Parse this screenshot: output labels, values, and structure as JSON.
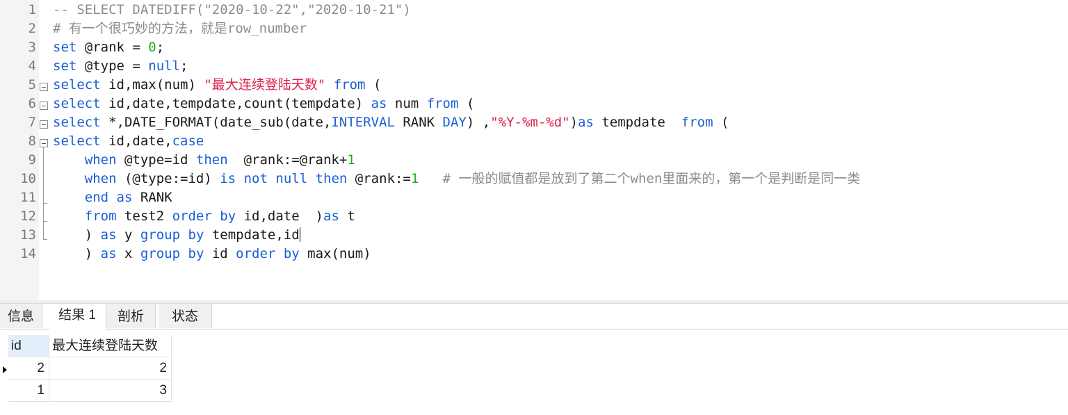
{
  "editor": {
    "lines": [
      {
        "n": "1",
        "segs": [
          {
            "t": "-- SELECT DATEDIFF(\"2020-10-22\",\"2020-10-21\")",
            "c": "cmt"
          }
        ]
      },
      {
        "n": "2",
        "segs": [
          {
            "t": "# 有一个很巧妙的方法，就是row_number",
            "c": "cmt"
          }
        ]
      },
      {
        "n": "3",
        "segs": [
          {
            "t": "set",
            "c": "kw"
          },
          {
            "t": " @rank = "
          },
          {
            "t": "0",
            "c": "num"
          },
          {
            "t": ";"
          }
        ]
      },
      {
        "n": "4",
        "segs": [
          {
            "t": "set",
            "c": "kw"
          },
          {
            "t": " @type = "
          },
          {
            "t": "null",
            "c": "kw"
          },
          {
            "t": ";"
          }
        ]
      },
      {
        "n": "5",
        "segs": [
          {
            "t": "select",
            "c": "kw"
          },
          {
            "t": " id,max(num) "
          },
          {
            "t": "\"最大连续登陆天数\"",
            "c": "str"
          },
          {
            "t": " "
          },
          {
            "t": "from",
            "c": "kw"
          },
          {
            "t": " ("
          }
        ]
      },
      {
        "n": "6",
        "segs": [
          {
            "t": "select",
            "c": "kw"
          },
          {
            "t": " id,date,tempdate,count(tempdate) "
          },
          {
            "t": "as",
            "c": "kw"
          },
          {
            "t": " num "
          },
          {
            "t": "from",
            "c": "kw"
          },
          {
            "t": " ("
          }
        ]
      },
      {
        "n": "7",
        "segs": [
          {
            "t": "select",
            "c": "kw"
          },
          {
            "t": " *,DATE_FORMAT(date_sub(date,"
          },
          {
            "t": "INTERVAL",
            "c": "kw"
          },
          {
            "t": " RANK "
          },
          {
            "t": "DAY",
            "c": "kw"
          },
          {
            "t": ") ,"
          },
          {
            "t": "\"%Y-%m-%d\"",
            "c": "str"
          },
          {
            "t": ")"
          },
          {
            "t": "as",
            "c": "kw"
          },
          {
            "t": " tempdate  "
          },
          {
            "t": "from",
            "c": "kw"
          },
          {
            "t": " ("
          }
        ]
      },
      {
        "n": "8",
        "segs": [
          {
            "t": "select",
            "c": "kw"
          },
          {
            "t": " id,date,"
          },
          {
            "t": "case",
            "c": "kw"
          }
        ]
      },
      {
        "n": "9",
        "segs": [
          {
            "t": "    "
          },
          {
            "t": "when",
            "c": "kw"
          },
          {
            "t": " @type=id "
          },
          {
            "t": "then",
            "c": "kw"
          },
          {
            "t": "  @rank:=@rank+"
          },
          {
            "t": "1",
            "c": "num"
          }
        ]
      },
      {
        "n": "10",
        "segs": [
          {
            "t": "    "
          },
          {
            "t": "when",
            "c": "kw"
          },
          {
            "t": " (@type:=id) "
          },
          {
            "t": "is",
            "c": "kw"
          },
          {
            "t": " "
          },
          {
            "t": "not",
            "c": "kw"
          },
          {
            "t": " "
          },
          {
            "t": "null",
            "c": "kw"
          },
          {
            "t": " "
          },
          {
            "t": "then",
            "c": "kw"
          },
          {
            "t": " @rank:="
          },
          {
            "t": "1",
            "c": "num"
          },
          {
            "t": "   # 一般的赋值都是放到了第二个when里面来的，第一个是判断是同一类",
            "c": "cmt"
          }
        ]
      },
      {
        "n": "11",
        "segs": [
          {
            "t": "    "
          },
          {
            "t": "end",
            "c": "kw"
          },
          {
            "t": " "
          },
          {
            "t": "as",
            "c": "kw"
          },
          {
            "t": " RANK"
          }
        ]
      },
      {
        "n": "12",
        "segs": [
          {
            "t": "    "
          },
          {
            "t": "from",
            "c": "kw"
          },
          {
            "t": " test2 "
          },
          {
            "t": "order",
            "c": "kw"
          },
          {
            "t": " "
          },
          {
            "t": "by",
            "c": "kw"
          },
          {
            "t": " id,date  )"
          },
          {
            "t": "as",
            "c": "kw"
          },
          {
            "t": " t"
          }
        ]
      },
      {
        "n": "13",
        "segs": [
          {
            "t": "    ) "
          },
          {
            "t": "as",
            "c": "kw"
          },
          {
            "t": " y "
          },
          {
            "t": "group",
            "c": "kw"
          },
          {
            "t": " "
          },
          {
            "t": "by",
            "c": "kw"
          },
          {
            "t": " tempdate,id"
          }
        ]
      },
      {
        "n": "14",
        "segs": [
          {
            "t": "    ) "
          },
          {
            "t": "as",
            "c": "kw"
          },
          {
            "t": " x "
          },
          {
            "t": "group",
            "c": "kw"
          },
          {
            "t": " "
          },
          {
            "t": "by",
            "c": "kw"
          },
          {
            "t": " id "
          },
          {
            "t": "order",
            "c": "kw"
          },
          {
            "t": " "
          },
          {
            "t": "by",
            "c": "kw"
          },
          {
            "t": " max(num)"
          }
        ]
      }
    ]
  },
  "tabs": {
    "info": "信息",
    "result1": "结果 1",
    "profile": "剖析",
    "status": "状态"
  },
  "grid": {
    "headers": [
      "id",
      "最大连续登陆天数"
    ],
    "rows": [
      [
        "2",
        "2"
      ],
      [
        "1",
        "3"
      ]
    ]
  },
  "colors": {
    "keyword": "#1a5fd6",
    "number": "#17b317",
    "string": "#e0204a",
    "comment": "#8c8c8c"
  }
}
